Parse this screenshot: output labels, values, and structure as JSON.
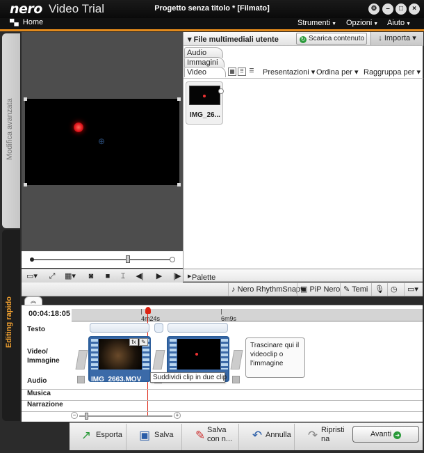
{
  "titlebar": {
    "logo": "nero",
    "app_name": "Video Trial",
    "document_title": "Progetto senza titolo * [Filmato]",
    "window_buttons": [
      "settings-icon",
      "minimize-icon",
      "maximize-icon",
      "close-icon"
    ]
  },
  "menubar": {
    "home": "Home",
    "menus": [
      "Strumenti",
      "Opzioni",
      "Aiuto"
    ]
  },
  "side_tabs": {
    "advanced": "Modifica avanzata",
    "quick": "Editing rapido"
  },
  "media_panel": {
    "title": "File multimediali utente",
    "scan_button": "Scarica contenuto",
    "import_button": "Importa",
    "tabs": [
      "Audio",
      "Immagini",
      "Video"
    ],
    "active_tab": "Video",
    "dropdowns": [
      "Presentazioni",
      "Ordina per",
      "Raggruppa per"
    ],
    "items": [
      {
        "name": "IMG_26..."
      }
    ]
  },
  "palette": {
    "label": "Palette effetti:"
  },
  "timeline_toolbar": {
    "rhythm_snap": "Nero RhythmSnap",
    "pip": "PiP Nero",
    "themes": "Temi"
  },
  "timeline": {
    "timecode": "00:04:18:05",
    "ruler_labels": [
      "4m24s",
      "6m9s"
    ],
    "tracks": [
      "Testo",
      "Video/ Immagine",
      "Audio",
      "Musica",
      "Narrazione"
    ],
    "clips": [
      {
        "name": "IMG_2663.MOV"
      }
    ],
    "drop_hint": "Trascinare qui il videoclip o l'immagine",
    "tooltip": "Suddividi clip in due clip",
    "clip_tools": [
      "fx",
      "✎"
    ]
  },
  "bottom_bar": {
    "buttons": [
      "Esporta",
      "Salva",
      "Salva con n...",
      "Annulla",
      "Ripristi na"
    ],
    "next": "Avanti"
  },
  "colors": {
    "accent": "#e38a1b",
    "clip_blue": "#3b6aa8",
    "playhead": "#d21"
  }
}
